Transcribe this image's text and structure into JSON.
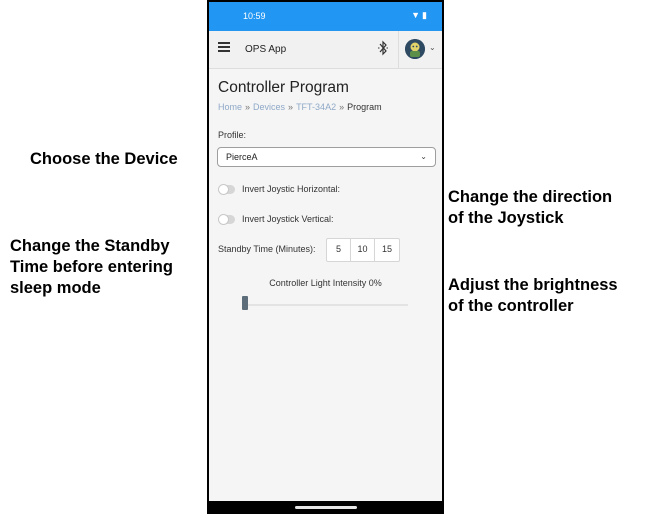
{
  "annotations": {
    "choose_device": "Choose the Device",
    "standby_time": "Change the Standby\nTime before entering\nsleep mode",
    "joystick_direction": "Change the direction\nof the Joystick",
    "brightness": "Adjust the brightness\nof the controller"
  },
  "status_bar": {
    "time": "10:59",
    "icons": [
      "wifi-icon",
      "battery-icon"
    ]
  },
  "app_bar": {
    "title": "OPS App",
    "icons": [
      "menu-icon",
      "bluetooth-icon",
      "avatar",
      "chevron-down-icon"
    ]
  },
  "page": {
    "title": "Controller Program",
    "breadcrumb": [
      {
        "label": "Home",
        "link": true
      },
      {
        "label": "Devices",
        "link": true
      },
      {
        "label": "TFT-34A2",
        "link": true
      },
      {
        "label": "Program",
        "link": false
      }
    ],
    "breadcrumb_separator": "»"
  },
  "profile": {
    "label": "Profile:",
    "selected": "PierceA"
  },
  "toggles": {
    "invert_horizontal": {
      "label": "Invert Joystic Horizontal:",
      "on": false
    },
    "invert_vertical": {
      "label": "Invert Joystick Vertical:",
      "on": false
    }
  },
  "standby": {
    "label": "Standby Time (Minutes):",
    "options": [
      "5",
      "10",
      "15"
    ]
  },
  "light": {
    "label": "Controller Light Intensity 0%",
    "value_percent": 0
  },
  "colors": {
    "status_bar": "#2196f3",
    "link": "#8fa9c8"
  }
}
